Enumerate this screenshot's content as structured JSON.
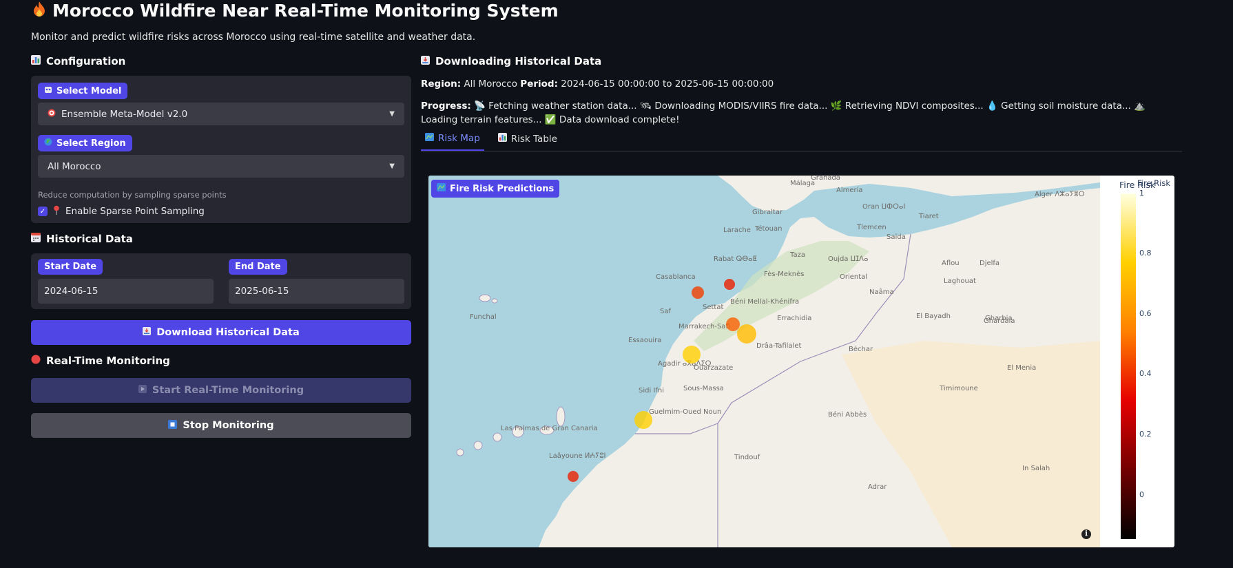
{
  "header": {
    "title": "Morocco Wildfire Near Real-Time Monitoring System",
    "subtitle": "Monitor and predict wildfire risks across Morocco using real-time satellite and weather data."
  },
  "config": {
    "heading": "Configuration",
    "model_label": "Select Model",
    "model_value": "Ensemble Meta-Model v2.0",
    "region_label": "Select Region",
    "region_value": "All Morocco",
    "sampling_hint": "Reduce computation by sampling sparse points",
    "sampling_checkbox_label": "Enable Sparse Point Sampling",
    "sampling_checked": true
  },
  "historical": {
    "heading": "Historical Data",
    "start_label": "Start Date",
    "start_value": "2024-06-15",
    "end_label": "End Date",
    "end_value": "2025-06-15",
    "download_button": "Download Historical Data"
  },
  "realtime": {
    "heading": "Real-Time Monitoring",
    "start_button": "Start Real-Time Monitoring",
    "stop_button": "Stop Monitoring"
  },
  "download_panel": {
    "heading": "Downloading Historical Data",
    "region_key": "Region:",
    "region_value": "All Morocco",
    "period_key": "Period:",
    "period_value": "2024-06-15 00:00:00 to 2025-06-15 00:00:00",
    "progress_key": "Progress:",
    "progress_text": "📡 Fetching weather station data... 🛰 Downloading MODIS/VIIRS fire data... 🌿 Retrieving NDVI composites... 💧 Getting soil moisture data... ⛰️ Loading terrain features... ✅ Data download complete!"
  },
  "tabs": [
    {
      "label": "Risk Map",
      "active": true
    },
    {
      "label": "Risk Table",
      "active": false
    }
  ],
  "map": {
    "badge": "Fire Risk Predictions",
    "colorbar_title": "Fire Risk",
    "colorbar_title_small": "Fire Risk",
    "colorbar_ticks": [
      "1",
      "0.8",
      "0.6",
      "0.4",
      "0.2",
      "0"
    ],
    "place_labels": [
      "Málaga",
      "Granada",
      "Almería",
      "Gibraltar",
      "Oran ⵡⵀⵔⴰⵏ",
      "Alger ⴷⵣⴰⵢⴻⵔ",
      "Tiaret",
      "Tlemcen",
      "Saïda",
      "Larache",
      "Tétouan",
      "Rabat ⵕⴱⴰⵟ",
      "Casablanca",
      "Oujda ⵡⵊⴷⴰ",
      "Taza",
      "Fès-Meknès",
      "Oriental",
      "Settat",
      "Béni Mellal-Khénifra",
      "Errachidia",
      "Marrakech-Safi",
      "Essaouira",
      "Drâa-Tafilalet",
      "Agadir ⴰⴳⴰⴷⵉⵔ",
      "Ouarzazate",
      "Sous-Massa",
      "Sidi Ifni",
      "Guelmim-Oued Noun",
      "Funchal",
      "Las Palmas de Gran Canaria",
      "Laâyoune ⵍⵄⵢⵓⵏ",
      "Laghouat",
      "Naâma",
      "El Bayadh",
      "Ghardaïa",
      "Béchar",
      "El Menia",
      "Timimoune",
      "Béni Abbès",
      "Tindouf",
      "In Salah",
      "Adrar",
      "Djelfa",
      "Aflou",
      "Saf",
      "Gharbia"
    ],
    "risk_points": [
      {
        "place": "Rabat",
        "risk": 0.45
      },
      {
        "place": "Casablanca",
        "risk": 0.5
      },
      {
        "place": "Béni Mellal",
        "risk": 0.55
      },
      {
        "place": "Khénifra",
        "risk": 0.75
      },
      {
        "place": "Marrakech",
        "risk": 0.8
      },
      {
        "place": "Guelmim",
        "risk": 0.8
      },
      {
        "place": "Laâyoune",
        "risk": 0.45
      }
    ]
  },
  "colors": {
    "accent": "#4f46e5",
    "background": "#0e1117",
    "panel": "#262730"
  }
}
